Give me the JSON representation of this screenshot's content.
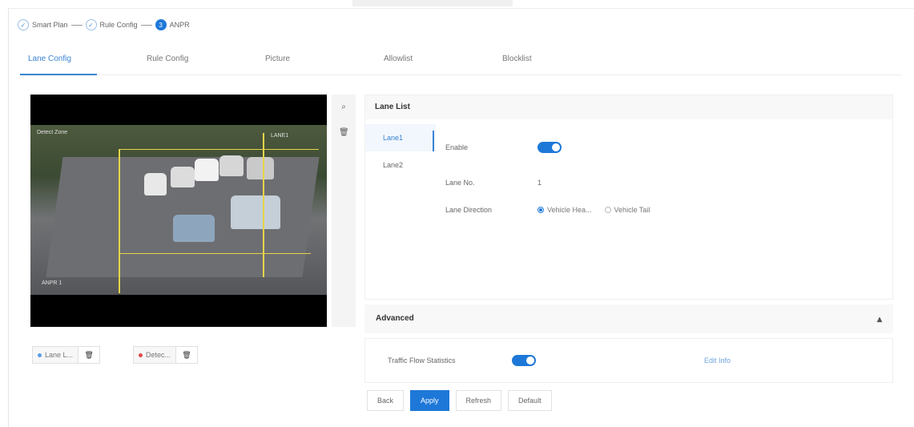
{
  "header": {
    "title": ""
  },
  "stepper": {
    "steps": [
      {
        "label": "Smart Plan",
        "state": "done"
      },
      {
        "label": "Rule Config",
        "state": "done"
      },
      {
        "label": "ANPR",
        "state": "active"
      }
    ]
  },
  "tabs": [
    {
      "label": "Lane Config",
      "active": true
    },
    {
      "label": "Rule Config"
    },
    {
      "label": "Picture"
    },
    {
      "label": "Allowlist"
    },
    {
      "label": "Blocklist"
    }
  ],
  "video": {
    "osd_top_left": "Detect Zone",
    "osd_top_right": "LANE1",
    "osd_bottom_left": "ANPR 1"
  },
  "side_tools": {
    "icons": [
      "search-icon",
      "trash-icon"
    ]
  },
  "draw_buttons": [
    {
      "label": "Lane L...",
      "dot_color": "#5b9be6"
    },
    {
      "label": "Detec...",
      "dot_color": "#e04a4a"
    }
  ],
  "lane_list": {
    "title": "Lane List",
    "lanes": [
      {
        "label": "Lane1",
        "active": true
      },
      {
        "label": "Lane2"
      }
    ],
    "enable_label": "Enable",
    "enable_value": true,
    "lane_no_label": "Lane No.",
    "lane_no_value": "1",
    "direction_label": "Lane Direction",
    "direction_options": [
      {
        "label": "Vehicle Hea...",
        "checked": true
      },
      {
        "label": "Vehicle Tail",
        "checked": false
      }
    ]
  },
  "advanced": {
    "title": "Advanced",
    "collapse_icon": "chevron-up-icon",
    "traffic_label": "Traffic Flow Statistics",
    "traffic_value": true,
    "link": "Edit Info"
  },
  "buttons": {
    "back": "Back",
    "apply": "Apply",
    "refresh": "Refresh",
    "default": "Default"
  },
  "colors": {
    "accent": "#1e78d8",
    "lane_lines": "#e6d44a"
  }
}
